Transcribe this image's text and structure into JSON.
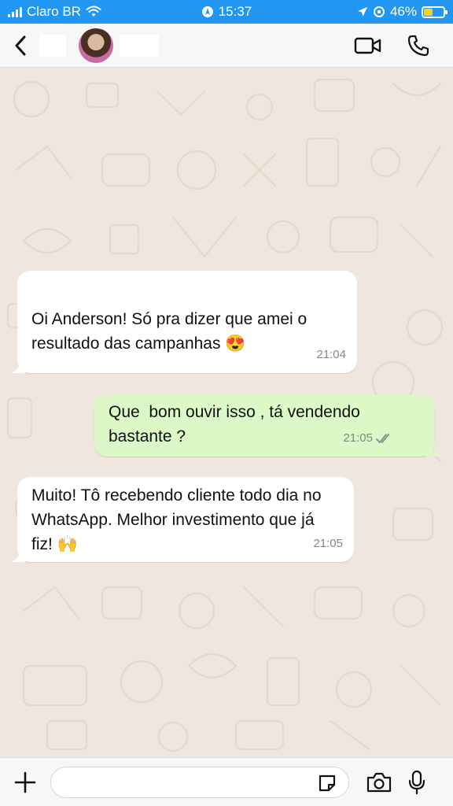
{
  "status_bar": {
    "carrier": "Claro BR",
    "time": "15:37",
    "battery_percent": "46%",
    "battery_level": 0.46,
    "signal_icon": "signal-icon",
    "wifi_icon": "wifi-icon"
  },
  "header": {
    "back_icon": "chevron-left-icon",
    "video_icon": "video-camera-icon",
    "call_icon": "phone-icon"
  },
  "messages": [
    {
      "direction": "incoming",
      "text": "Oi Anderson! Só pra dizer que amei o resultado das campanhas 😍",
      "time": "21:04"
    },
    {
      "direction": "outgoing",
      "text": "Que  bom ouvir isso , tá vendendo bastante ?",
      "time": "21:05",
      "status": "read"
    },
    {
      "direction": "incoming",
      "text": "Muito! Tô recebendo cliente todo dia no WhatsApp. Melhor investimento que já fiz! 🙌",
      "time": "21:05"
    }
  ],
  "input_bar": {
    "placeholder": "",
    "value": ""
  },
  "colors": {
    "status_bar": "#2196f3",
    "chat_background": "#efe7de",
    "incoming_bubble": "#ffffff",
    "outgoing_bubble": "#dcf8c6",
    "read_ticks": "#7d8a86"
  }
}
